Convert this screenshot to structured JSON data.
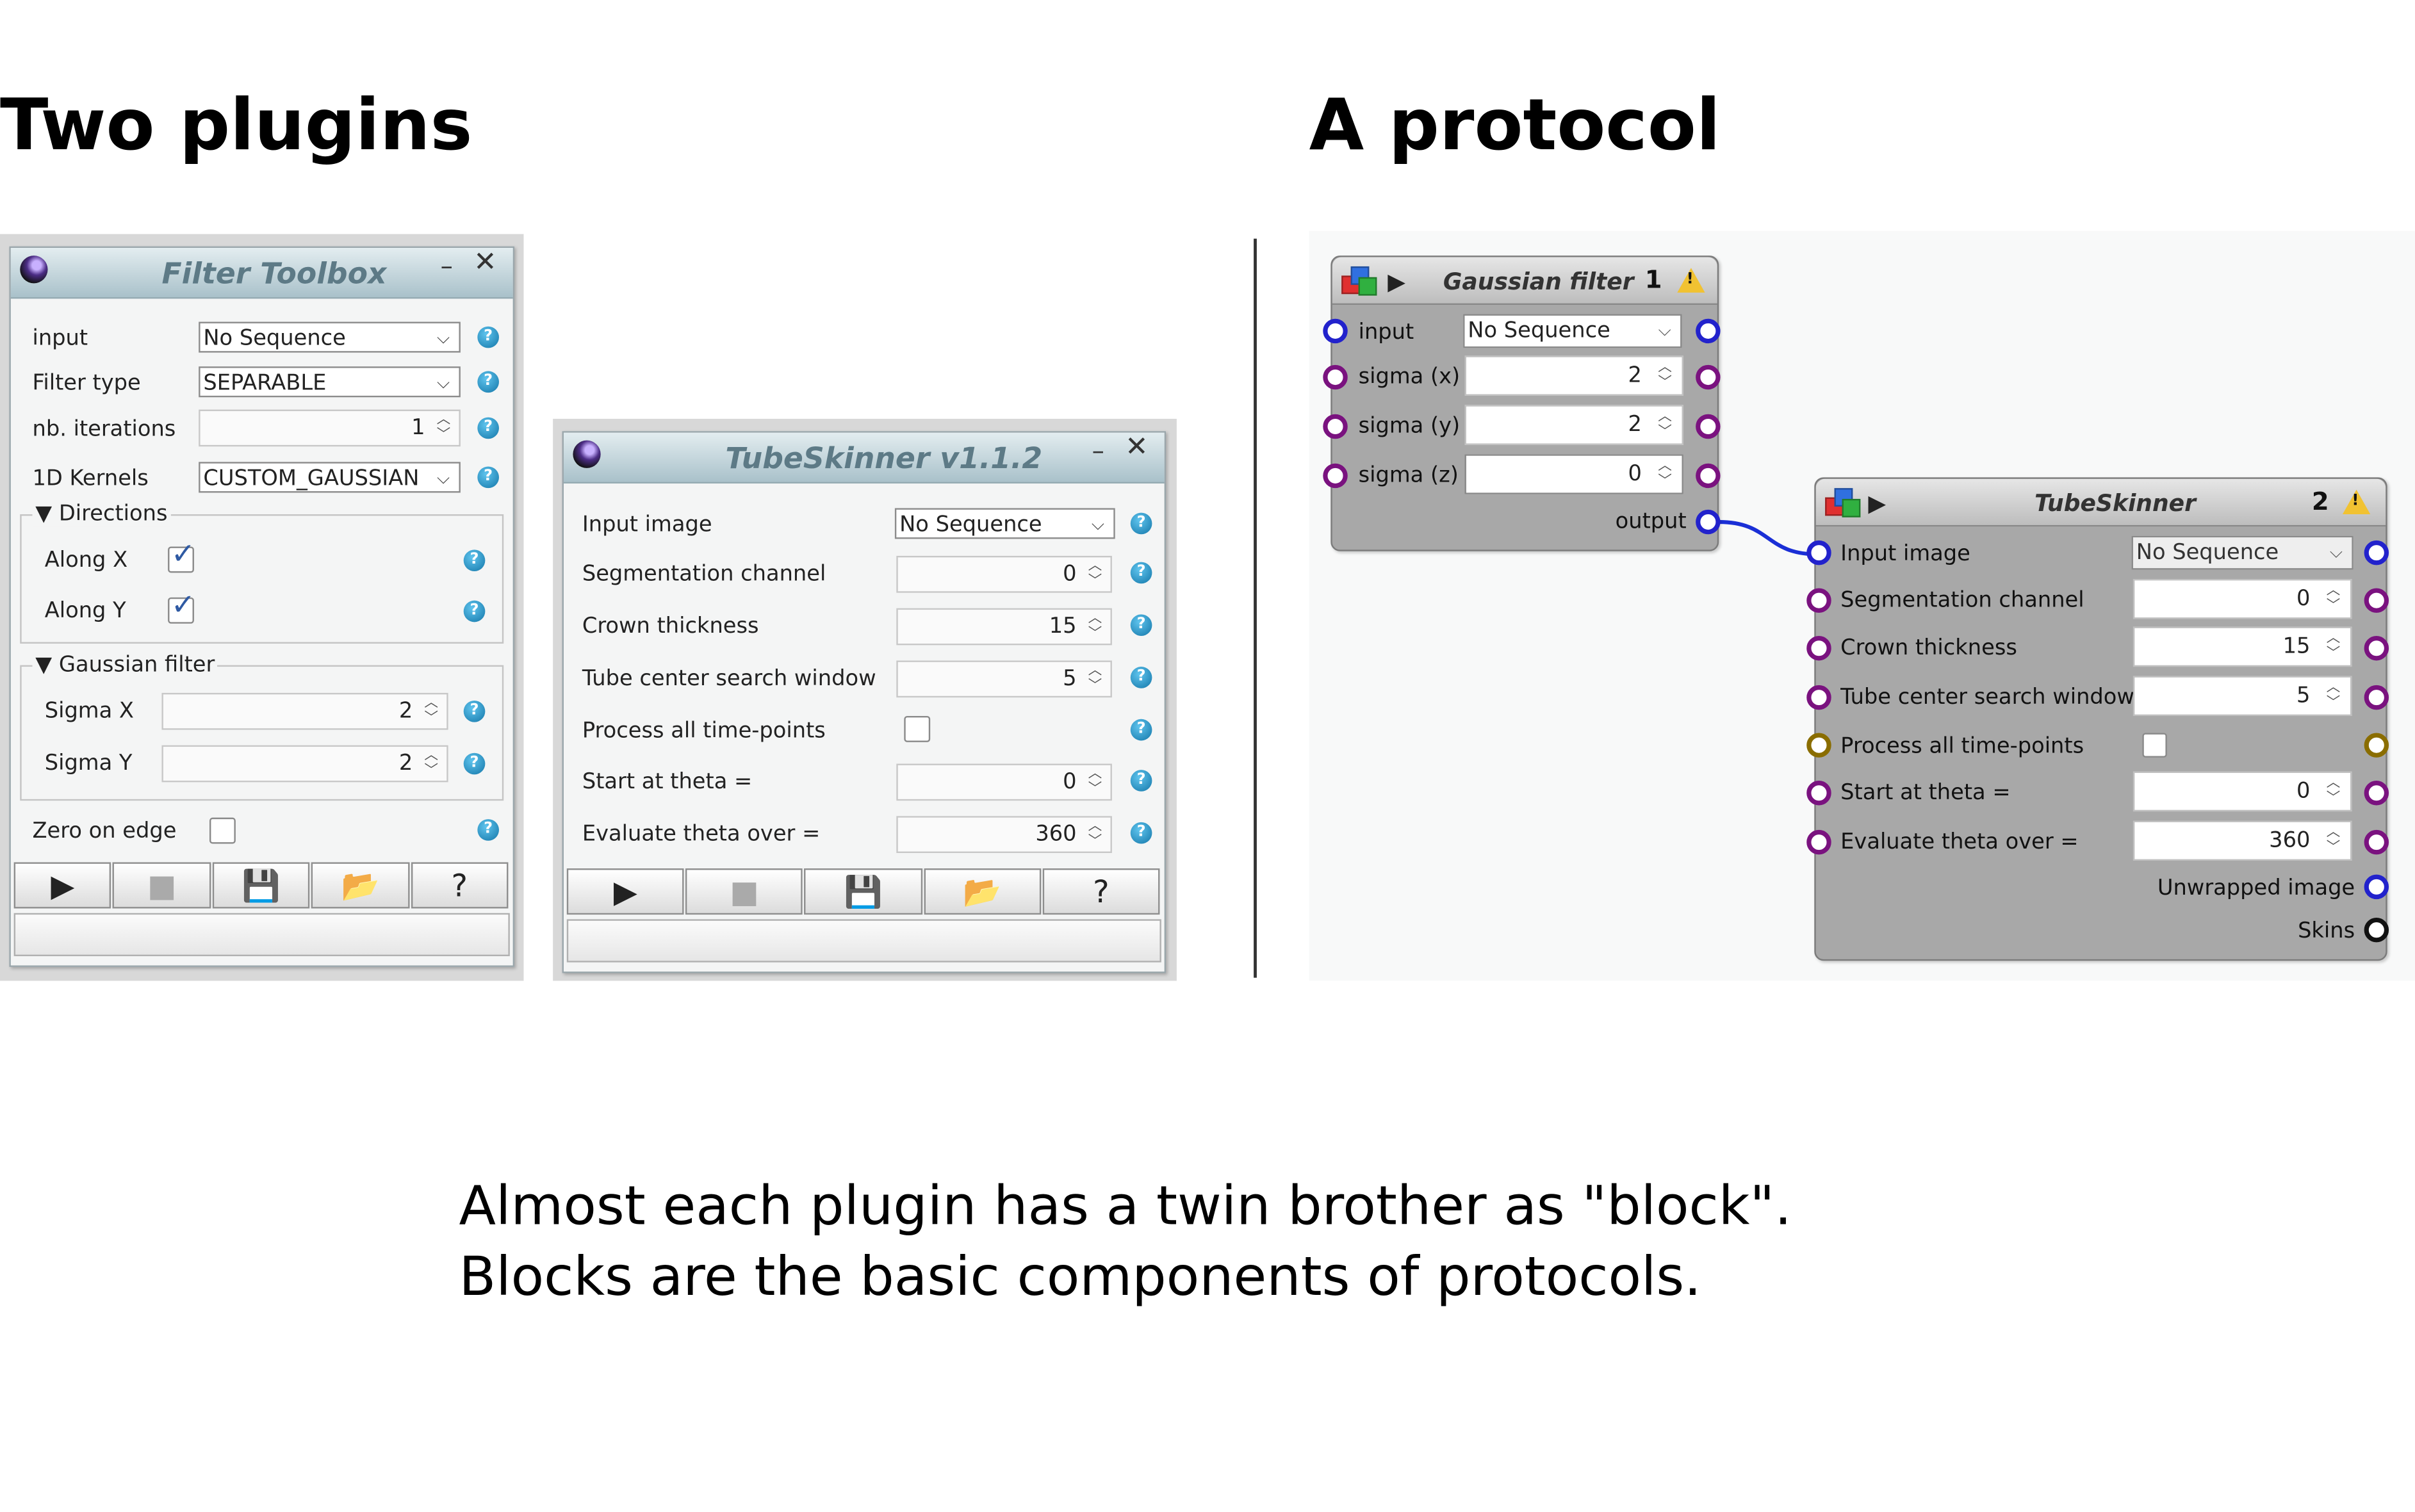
{
  "headings": {
    "left": "Two plugins",
    "right": "A protocol"
  },
  "filter_toolbox": {
    "title": "Filter Toolbox",
    "input_label": "input",
    "input_value": "No Sequence",
    "filter_type_label": "Filter type",
    "filter_type_value": "SEPARABLE",
    "iterations_label": "nb. iterations",
    "iterations_value": "1",
    "kernels_label": "1D Kernels",
    "kernels_value": "CUSTOM_GAUSSIAN",
    "directions_title": "Directions",
    "along_x_label": "Along X",
    "along_x_checked": true,
    "along_y_label": "Along Y",
    "along_y_checked": true,
    "gaussian_title": "Gaussian filter",
    "sigma_x_label": "Sigma X",
    "sigma_x_value": "2",
    "sigma_y_label": "Sigma Y",
    "sigma_y_value": "2",
    "zero_edge_label": "Zero on edge",
    "zero_edge_checked": false,
    "help_glyph": "?"
  },
  "tubeskinner_plugin": {
    "title": "TubeSkinner v1.1.2",
    "input_label": "Input image",
    "input_value": "No Sequence",
    "seg_label": "Segmentation channel",
    "seg_value": "0",
    "crown_label": "Crown thickness",
    "crown_value": "15",
    "window_label": "Tube center search window",
    "window_value": "5",
    "process_label": "Process all time-points",
    "process_checked": false,
    "theta_label": "Start at theta =",
    "theta_value": "0",
    "eval_label": "Evaluate theta over =",
    "eval_value": "360"
  },
  "toolbar_buttons": {
    "run": "play-icon",
    "stop": "stop-icon",
    "save": "save-icon",
    "open": "folder-open-icon",
    "help": "?"
  },
  "gaussian_block": {
    "name": "Gaussian filter",
    "number": "1",
    "input_label": "input",
    "input_value": "No Sequence",
    "sigma_x_label": "sigma (x)",
    "sigma_x_value": "2",
    "sigma_y_label": "sigma (y)",
    "sigma_y_value": "2",
    "sigma_z_label": "sigma (z)",
    "sigma_z_value": "0",
    "output_label": "output"
  },
  "tubeskinner_block": {
    "name": "TubeSkinner",
    "number": "2",
    "input_label": "Input image",
    "input_value": "No Sequence",
    "seg_label": "Segmentation channel",
    "seg_value": "0",
    "crown_label": "Crown thickness",
    "crown_value": "15",
    "window_label": "Tube center search window",
    "window_value": "5",
    "process_label": "Process all time-points",
    "process_checked": false,
    "theta_label": "Start at theta =",
    "theta_value": "0",
    "eval_label": "Evaluate theta over =",
    "eval_value": "360",
    "unwrapped_label": "Unwrapped image",
    "skins_label": "Skins"
  },
  "caption": {
    "line1": "Almost each plugin has a twin brother as \"block\".",
    "line2": "Blocks are the basic components of protocols."
  },
  "colors": {
    "port_sequence": "#2222cc",
    "port_number": "#7a127f",
    "port_boolean": "#8a6d00",
    "link": "#1a2fd6",
    "warning": "#f1c232",
    "help": "#1376a8"
  }
}
